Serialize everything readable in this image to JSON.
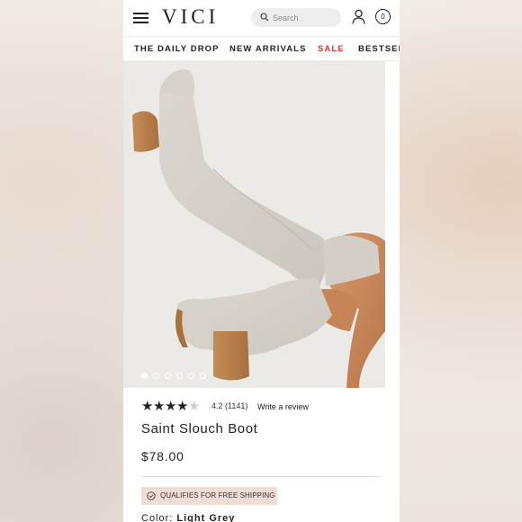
{
  "header": {
    "logo": "VICI",
    "search_placeholder": "Search",
    "cart_count": "0",
    "icons": [
      "menu-icon",
      "search-icon",
      "account-icon",
      "cart-icon"
    ]
  },
  "nav": {
    "items": [
      {
        "label": "THE DAILY DROP"
      },
      {
        "label": "NEW ARRIVALS"
      },
      {
        "label": "SALE",
        "color": "#d0343c"
      },
      {
        "label": "BESTSELLERS"
      }
    ]
  },
  "gallery": {
    "image_count": 6,
    "active_index": 0
  },
  "product": {
    "rating_value": 4.2,
    "rating_text": "4.2",
    "review_count": "(1141)",
    "write_review": "Write a review",
    "title": "Saint Slouch Boot",
    "price": "$78.00",
    "shipping_badge": "QUALIFIES FOR FREE SHIPPING",
    "color_label": "Color:",
    "color_value": "Light Grey"
  },
  "colors": {
    "sale": "#d0343c",
    "badge_bg": "#f2ddd4",
    "text": "#222222"
  }
}
